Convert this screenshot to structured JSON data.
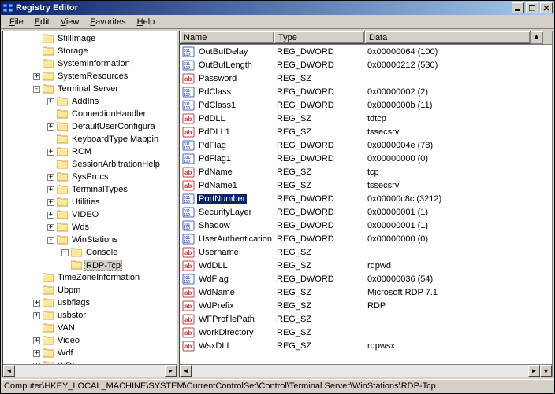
{
  "window": {
    "title": "Registry Editor"
  },
  "menu": [
    "File",
    "Edit",
    "View",
    "Favorites",
    "Help"
  ],
  "tree": [
    {
      "indent": 2,
      "toggle": "",
      "label": "StillImage"
    },
    {
      "indent": 2,
      "toggle": "",
      "label": "Storage"
    },
    {
      "indent": 2,
      "toggle": "",
      "label": "SystemInformation"
    },
    {
      "indent": 2,
      "toggle": "+",
      "label": "SystemResources"
    },
    {
      "indent": 2,
      "toggle": "-",
      "label": "Terminal Server"
    },
    {
      "indent": 3,
      "toggle": "+",
      "label": "AddIns"
    },
    {
      "indent": 3,
      "toggle": "",
      "label": "ConnectionHandler"
    },
    {
      "indent": 3,
      "toggle": "+",
      "label": "DefaultUserConfigura"
    },
    {
      "indent": 3,
      "toggle": "",
      "label": "KeyboardType Mappin"
    },
    {
      "indent": 3,
      "toggle": "+",
      "label": "RCM"
    },
    {
      "indent": 3,
      "toggle": "",
      "label": "SessionArbitrationHelp"
    },
    {
      "indent": 3,
      "toggle": "+",
      "label": "SysProcs"
    },
    {
      "indent": 3,
      "toggle": "+",
      "label": "TerminalTypes"
    },
    {
      "indent": 3,
      "toggle": "+",
      "label": "Utilities"
    },
    {
      "indent": 3,
      "toggle": "+",
      "label": "VIDEO"
    },
    {
      "indent": 3,
      "toggle": "+",
      "label": "Wds"
    },
    {
      "indent": 3,
      "toggle": "-",
      "label": "WinStations"
    },
    {
      "indent": 4,
      "toggle": "+",
      "label": "Console"
    },
    {
      "indent": 4,
      "toggle": "",
      "label": "RDP-Tcp",
      "selected": true
    },
    {
      "indent": 2,
      "toggle": "",
      "label": "TimeZoneInformation"
    },
    {
      "indent": 2,
      "toggle": "",
      "label": "Ubpm"
    },
    {
      "indent": 2,
      "toggle": "+",
      "label": "usbflags"
    },
    {
      "indent": 2,
      "toggle": "+",
      "label": "usbstor"
    },
    {
      "indent": 2,
      "toggle": "",
      "label": "VAN"
    },
    {
      "indent": 2,
      "toggle": "+",
      "label": "Video"
    },
    {
      "indent": 2,
      "toggle": "+",
      "label": "Wdf"
    },
    {
      "indent": 2,
      "toggle": "+",
      "label": "WDI"
    }
  ],
  "columns": {
    "name": "Name",
    "type": "Type",
    "data": "Data"
  },
  "colwidths": {
    "name": 120,
    "type": 115,
    "data": 210
  },
  "values": [
    {
      "icon": "bin",
      "name": "OutBufDelay",
      "type": "REG_DWORD",
      "data": "0x00000064 (100)"
    },
    {
      "icon": "bin",
      "name": "OutBufLength",
      "type": "REG_DWORD",
      "data": "0x00000212 (530)"
    },
    {
      "icon": "str",
      "name": "Password",
      "type": "REG_SZ",
      "data": ""
    },
    {
      "icon": "bin",
      "name": "PdClass",
      "type": "REG_DWORD",
      "data": "0x00000002 (2)"
    },
    {
      "icon": "bin",
      "name": "PdClass1",
      "type": "REG_DWORD",
      "data": "0x0000000b (11)"
    },
    {
      "icon": "str",
      "name": "PdDLL",
      "type": "REG_SZ",
      "data": "tdtcp"
    },
    {
      "icon": "str",
      "name": "PdDLL1",
      "type": "REG_SZ",
      "data": "tssecsrv"
    },
    {
      "icon": "bin",
      "name": "PdFlag",
      "type": "REG_DWORD",
      "data": "0x0000004e (78)"
    },
    {
      "icon": "bin",
      "name": "PdFlag1",
      "type": "REG_DWORD",
      "data": "0x00000000 (0)"
    },
    {
      "icon": "str",
      "name": "PdName",
      "type": "REG_SZ",
      "data": "tcp"
    },
    {
      "icon": "str",
      "name": "PdName1",
      "type": "REG_SZ",
      "data": "tssecsrv"
    },
    {
      "icon": "bin",
      "name": "PortNumber",
      "type": "REG_DWORD",
      "data": "0x00000c8c (3212)",
      "selected": true
    },
    {
      "icon": "bin",
      "name": "SecurityLayer",
      "type": "REG_DWORD",
      "data": "0x00000001 (1)"
    },
    {
      "icon": "bin",
      "name": "Shadow",
      "type": "REG_DWORD",
      "data": "0x00000001 (1)"
    },
    {
      "icon": "bin",
      "name": "UserAuthentication",
      "type": "REG_DWORD",
      "data": "0x00000000 (0)"
    },
    {
      "icon": "str",
      "name": "Username",
      "type": "REG_SZ",
      "data": ""
    },
    {
      "icon": "str",
      "name": "WdDLL",
      "type": "REG_SZ",
      "data": "rdpwd"
    },
    {
      "icon": "bin",
      "name": "WdFlag",
      "type": "REG_DWORD",
      "data": "0x00000036 (54)"
    },
    {
      "icon": "str",
      "name": "WdName",
      "type": "REG_SZ",
      "data": "Microsoft RDP 7.1"
    },
    {
      "icon": "str",
      "name": "WdPrefix",
      "type": "REG_SZ",
      "data": "RDP"
    },
    {
      "icon": "str",
      "name": "WFProfilePath",
      "type": "REG_SZ",
      "data": ""
    },
    {
      "icon": "str",
      "name": "WorkDirectory",
      "type": "REG_SZ",
      "data": ""
    },
    {
      "icon": "str",
      "name": "WsxDLL",
      "type": "REG_SZ",
      "data": "rdpwsx"
    }
  ],
  "status": "Computer\\HKEY_LOCAL_MACHINE\\SYSTEM\\CurrentControlSet\\Control\\Terminal Server\\WinStations\\RDP-Tcp"
}
